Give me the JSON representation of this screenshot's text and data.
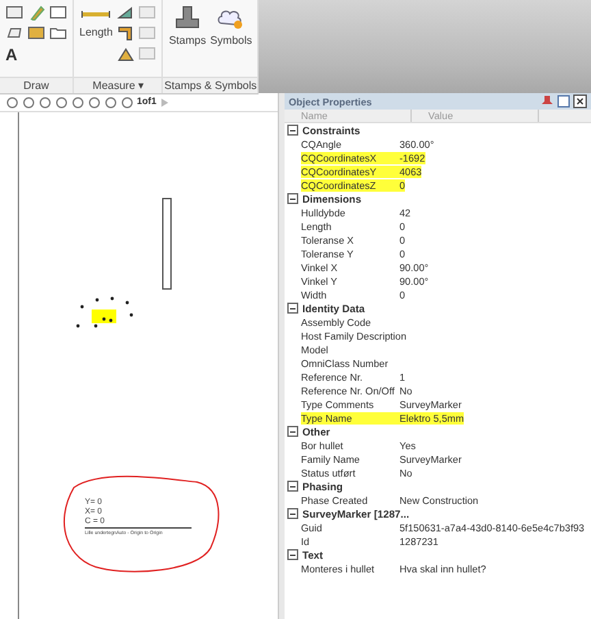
{
  "ribbon": {
    "groups": [
      {
        "label": "Draw",
        "text_tool": "A"
      },
      {
        "label": "Measure",
        "caret": "▾",
        "button": "Length"
      },
      {
        "label": "Stamps & Symbols",
        "buttons": [
          "Stamps",
          "Symbols"
        ]
      }
    ]
  },
  "viewer": {
    "page_indicator": "1of1",
    "markup": {
      "lines": [
        "Y= 0",
        "X= 0",
        "C = 0"
      ],
      "caption": "Lille undertegnAuto - Origin to Origin"
    }
  },
  "properties": {
    "title": "Object Properties",
    "columns": [
      "Name",
      "Value"
    ],
    "sections": [
      {
        "name": "Constraints",
        "expanded": true,
        "rows": [
          {
            "name": "CQAngle",
            "value": "360.00°",
            "highlighted": false
          },
          {
            "name": "CQCoordinatesX",
            "value": "-1692",
            "highlighted": true
          },
          {
            "name": "CQCoordinatesY",
            "value": "4063",
            "highlighted": true
          },
          {
            "name": "CQCoordinatesZ",
            "value": "0",
            "highlighted": true
          }
        ]
      },
      {
        "name": "Dimensions",
        "expanded": true,
        "rows": [
          {
            "name": "Hulldybde",
            "value": "42",
            "highlighted": false
          },
          {
            "name": "Length",
            "value": "0",
            "highlighted": false
          },
          {
            "name": "Toleranse X",
            "value": "0",
            "highlighted": false
          },
          {
            "name": "Toleranse Y",
            "value": "0",
            "highlighted": false
          },
          {
            "name": "Vinkel X",
            "value": "90.00°",
            "highlighted": false
          },
          {
            "name": "Vinkel Y",
            "value": "90.00°",
            "highlighted": false
          },
          {
            "name": "Width",
            "value": "0",
            "highlighted": false
          }
        ]
      },
      {
        "name": "Identity Data",
        "expanded": true,
        "rows": [
          {
            "name": "Assembly Code",
            "highlighted": false
          },
          {
            "name": "Host Family Description",
            "highlighted": false
          },
          {
            "name": "Model",
            "highlighted": false
          },
          {
            "name": "OmniClass Number",
            "highlighted": false
          },
          {
            "name": "Reference Nr.",
            "value": "1",
            "highlighted": false
          },
          {
            "name": "Reference Nr. On/Off",
            "value": "No",
            "highlighted": false
          },
          {
            "name": "Type Comments",
            "value": "SurveyMarker",
            "highlighted": false
          },
          {
            "name": "Type Name",
            "value": "Elektro 5,5mm",
            "highlighted": true
          }
        ]
      },
      {
        "name": "Other",
        "expanded": true,
        "rows": [
          {
            "name": "Bor hullet",
            "value": "Yes",
            "highlighted": false
          },
          {
            "name": "Family Name",
            "value": "SurveyMarker",
            "highlighted": false
          },
          {
            "name": "Status utført",
            "value": "No",
            "highlighted": false
          }
        ]
      },
      {
        "name": "Phasing",
        "expanded": true,
        "rows": [
          {
            "name": "Phase Created",
            "value": "New Construction",
            "highlighted": false
          }
        ]
      },
      {
        "name": "SurveyMarker [1287...",
        "expanded": true,
        "rows": [
          {
            "name": "Guid",
            "value": "5f150631-a7a4-43d0-8140-6e5e4c7b3f93",
            "highlighted": false
          },
          {
            "name": "Id",
            "value": "1287231",
            "highlighted": false
          }
        ]
      },
      {
        "name": "Text",
        "expanded": true,
        "rows": [
          {
            "name": "Monteres i hullet",
            "value": "Hva skal inn hullet?",
            "highlighted": false
          }
        ]
      }
    ]
  }
}
